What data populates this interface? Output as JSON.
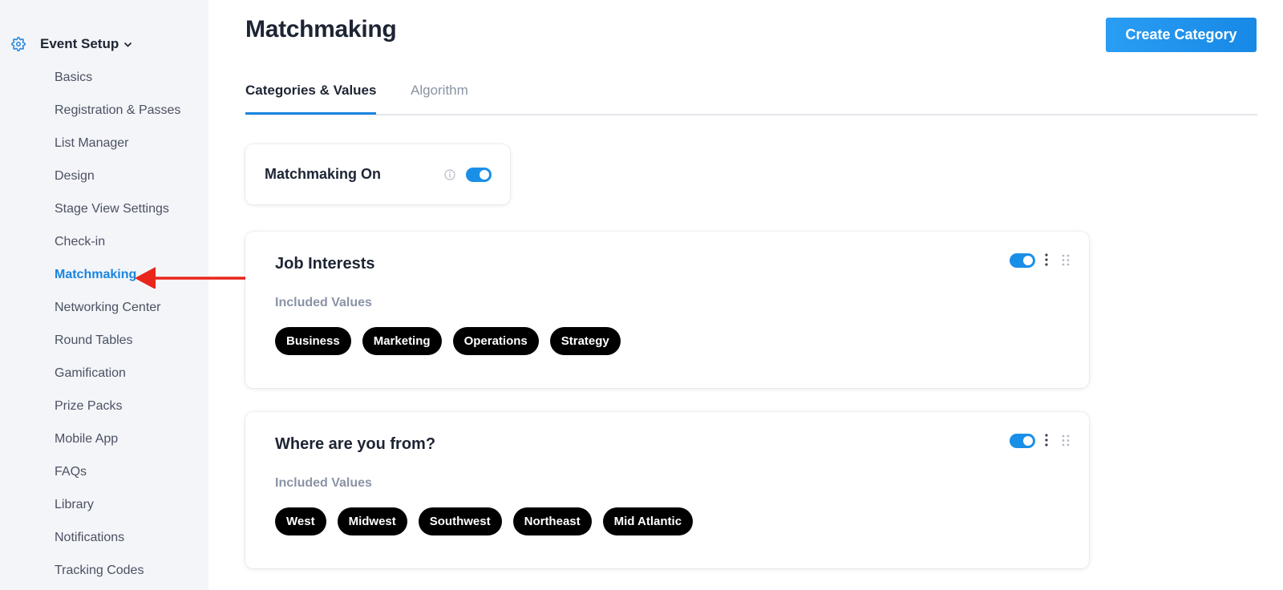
{
  "sidebar": {
    "section_title": "Event Setup",
    "section_icon": "gear-icon",
    "items": [
      {
        "label": "Basics",
        "active": false
      },
      {
        "label": "Registration & Passes",
        "active": false
      },
      {
        "label": "List Manager",
        "active": false
      },
      {
        "label": "Design",
        "active": false
      },
      {
        "label": "Stage View Settings",
        "active": false
      },
      {
        "label": "Check-in",
        "active": false
      },
      {
        "label": "Matchmaking",
        "active": true
      },
      {
        "label": "Networking Center",
        "active": false
      },
      {
        "label": "Round Tables",
        "active": false
      },
      {
        "label": "Gamification",
        "active": false
      },
      {
        "label": "Prize Packs",
        "active": false
      },
      {
        "label": "Mobile App",
        "active": false
      },
      {
        "label": "FAQs",
        "active": false
      },
      {
        "label": "Library",
        "active": false
      },
      {
        "label": "Notifications",
        "active": false
      },
      {
        "label": "Tracking Codes",
        "active": false
      }
    ]
  },
  "header": {
    "title": "Matchmaking",
    "create_button": "Create Category"
  },
  "tabs": [
    {
      "label": "Categories & Values",
      "active": true
    },
    {
      "label": "Algorithm",
      "active": false
    }
  ],
  "matchmaking_toggle": {
    "label": "Matchmaking On",
    "enabled": true
  },
  "categories": [
    {
      "title": "Job Interests",
      "included_label": "Included Values",
      "enabled": true,
      "values": [
        "Business",
        "Marketing",
        "Operations",
        "Strategy"
      ]
    },
    {
      "title": "Where are you from?",
      "included_label": "Included Values",
      "enabled": true,
      "values": [
        "West",
        "Midwest",
        "Southwest",
        "Northeast",
        "Mid Atlantic"
      ]
    }
  ],
  "colors": {
    "accent": "#1a85e0",
    "annotation_arrow": "#e8261c",
    "chip_bg": "#000000",
    "sidebar_bg": "#f4f5f8"
  }
}
